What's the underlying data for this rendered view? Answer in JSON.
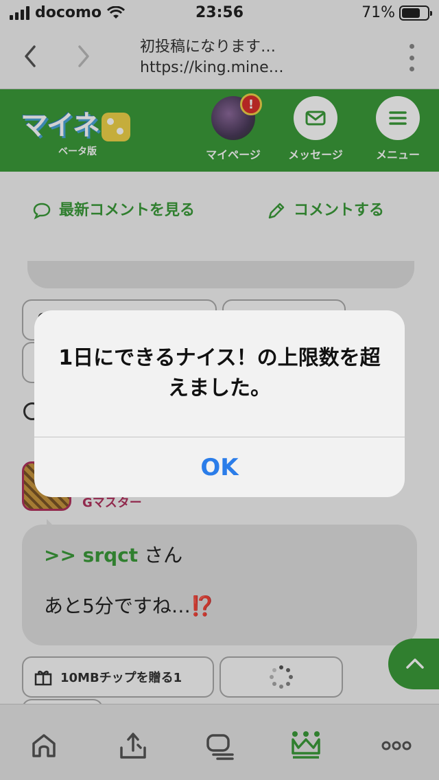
{
  "status_bar": {
    "carrier": "docomo",
    "time": "23:56",
    "battery": "71%",
    "battery_level": 0.71
  },
  "browser": {
    "page_title": "初投稿になります…",
    "url": "https://king.mine…"
  },
  "header": {
    "logo_sub": "ベータ版",
    "mypage_label": "マイページ",
    "mypage_badge": "!",
    "message_label": "メッセージ",
    "menu_label": "メニュー"
  },
  "actions": {
    "latest_comments": "最新コメントを見る",
    "comment": "コメントする"
  },
  "comment": {
    "rank": "Gマスター",
    "reply_to": ">> srqct",
    "reply_suffix": " さん",
    "text": "あと5分ですね…",
    "emoji": "⁉️"
  },
  "chips": {
    "gift": "10MBチップを贈る1"
  },
  "dialog": {
    "message": "1日にできるナイス！の上限数を超えました。",
    "ok_label": "OK"
  },
  "colors": {
    "brand_green": "#3b9c3a",
    "rank_pink": "#b1335f",
    "dialog_blue": "#2b7de9",
    "alert_red": "#d9302c"
  },
  "tabbar": {
    "icons": [
      "home-icon",
      "upload-icon",
      "post-icon",
      "crown-icon",
      "more-icon"
    ],
    "active": "crown-icon"
  }
}
